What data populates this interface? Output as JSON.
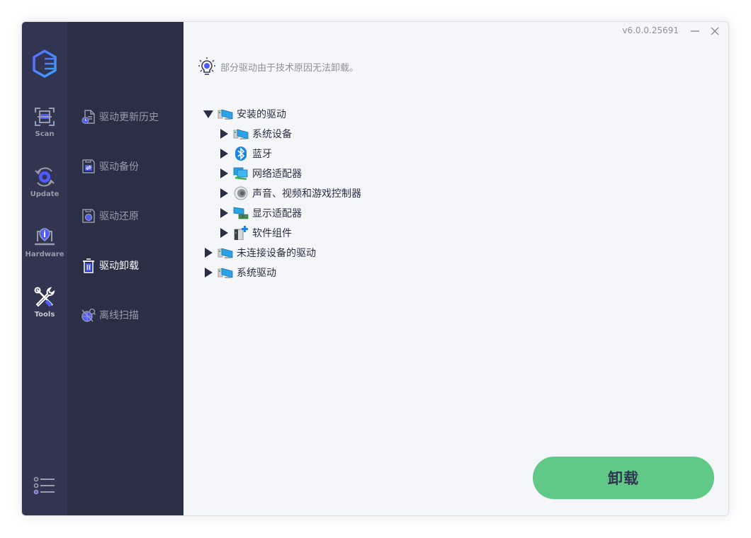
{
  "app": {
    "version": "v6.0.0.25691",
    "minimize_icon": "minimize-icon",
    "close_icon": "close-icon",
    "logo_icon": "hexagon-logo-icon"
  },
  "rail": {
    "items": [
      {
        "label": "Scan",
        "icon": "scan-icon"
      },
      {
        "label": "Update",
        "icon": "update-gear-icon"
      },
      {
        "label": "Hardware",
        "icon": "hardware-info-icon"
      },
      {
        "label": "Tools",
        "icon": "tools-icon",
        "active": true
      }
    ],
    "menu_icon": "list-menu-icon"
  },
  "subnav": {
    "items": [
      {
        "label": "驱动更新历史",
        "icon": "history-document-icon"
      },
      {
        "label": "驱动备份",
        "icon": "backup-icon"
      },
      {
        "label": "驱动还原",
        "icon": "restore-icon"
      },
      {
        "label": "驱动卸载",
        "icon": "trash-icon",
        "active": true
      },
      {
        "label": "离线扫描",
        "icon": "offline-scan-icon"
      }
    ]
  },
  "main": {
    "notice": "部分驱动由于技术原因无法卸载。",
    "notice_icon": "lightbulb-icon",
    "tree": [
      {
        "label": "安装的驱动",
        "expanded": true,
        "icon": "computer-icon",
        "children": [
          {
            "label": "系统设备",
            "icon": "computer-icon"
          },
          {
            "label": "蓝牙",
            "icon": "bluetooth-icon"
          },
          {
            "label": "网络适配器",
            "icon": "network-adapter-icon"
          },
          {
            "label": "声音、视频和游戏控制器",
            "icon": "speaker-icon"
          },
          {
            "label": "显示适配器",
            "icon": "display-adapter-icon"
          },
          {
            "label": "软件组件",
            "icon": "software-component-icon"
          }
        ]
      },
      {
        "label": "未连接设备的驱动",
        "expanded": false,
        "icon": "computer-icon"
      },
      {
        "label": "系统驱动",
        "expanded": false,
        "icon": "computer-icon"
      }
    ],
    "uninstall_button": "卸载"
  },
  "colors": {
    "rail_bg": "#313552",
    "subnav_bg": "#2b2f45",
    "main_bg": "#f5f6fa",
    "accent": "#4f5bff",
    "button_green": "#60c987"
  }
}
